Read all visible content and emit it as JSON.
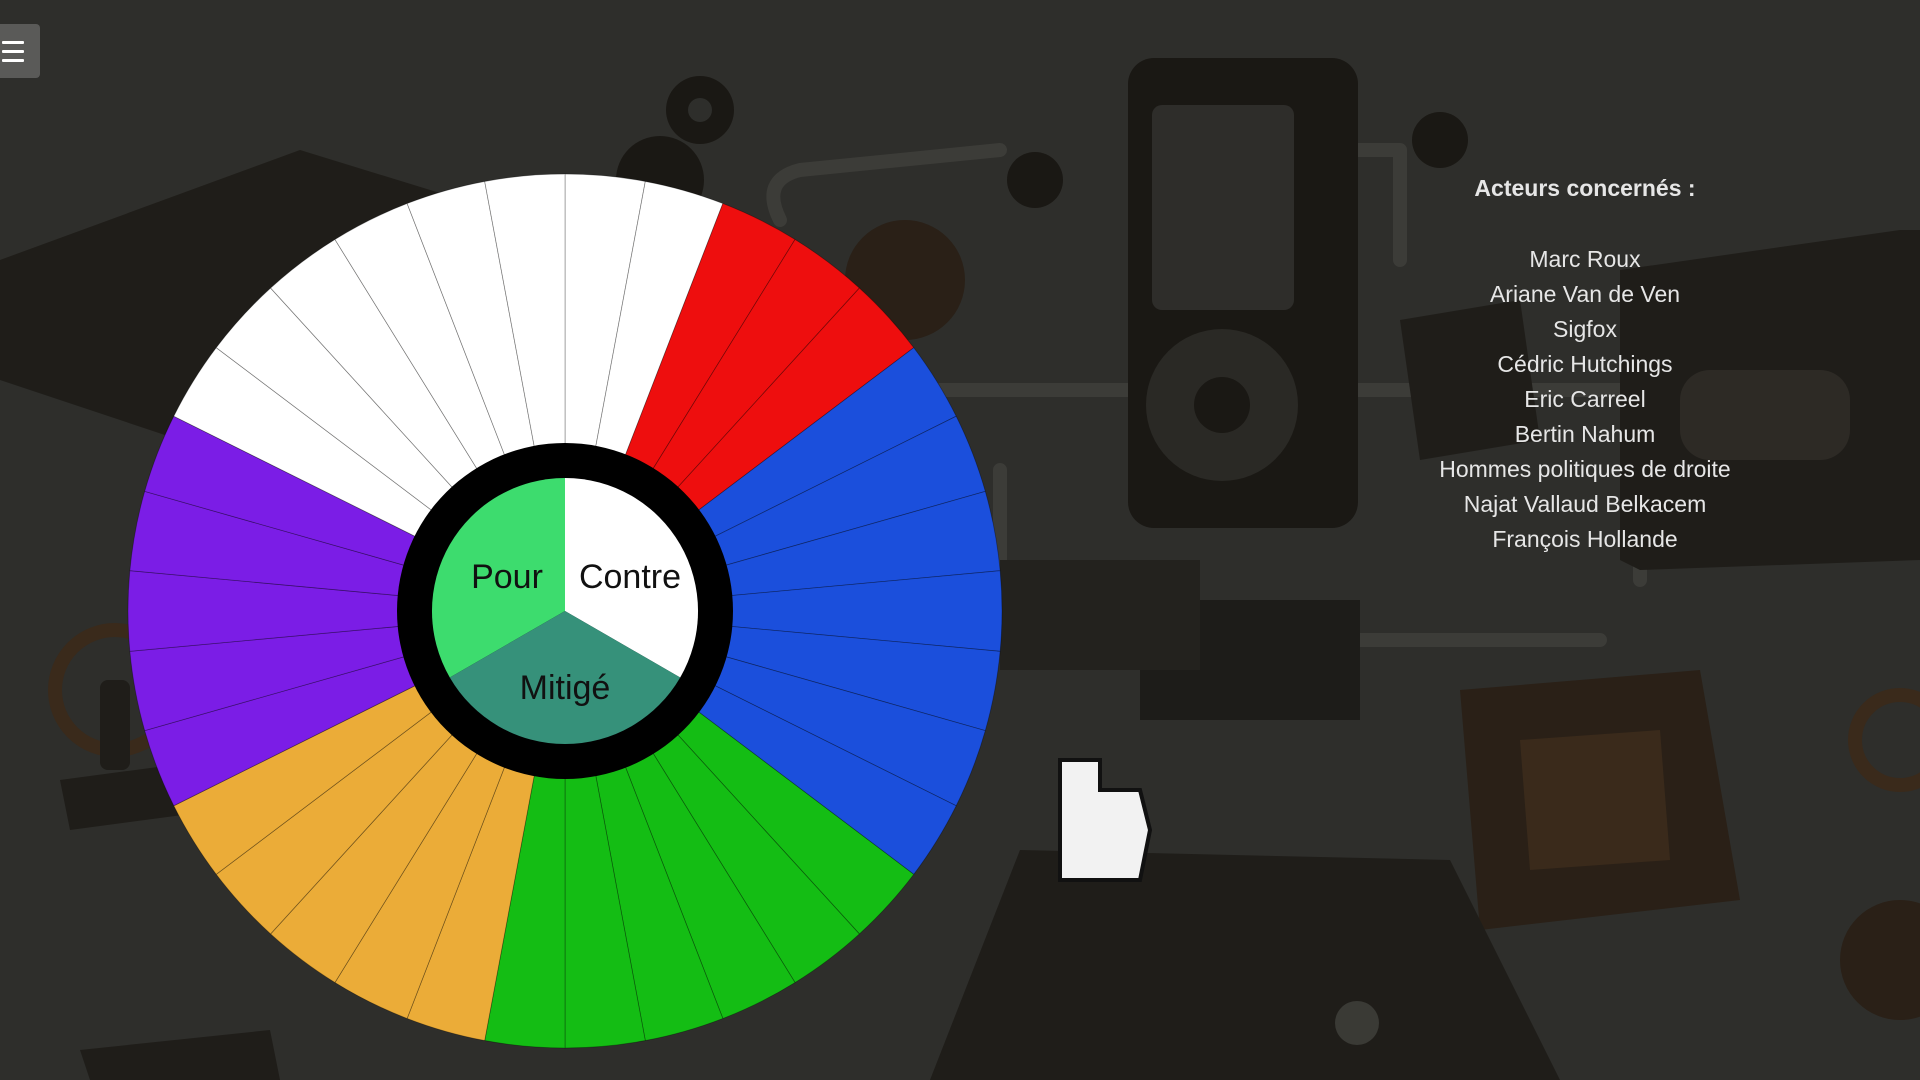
{
  "menu": {
    "icon": "hamburger-menu-icon"
  },
  "wheel": {
    "segment_colors": {
      "white": "#ffffff",
      "red": "#ee0e0e",
      "blue": "#1b4fdc",
      "green": "#14bd14",
      "orange": "#ebac38",
      "purple": "#7b1de6"
    },
    "segments": [
      "white",
      "white",
      "red",
      "red",
      "red",
      "blue",
      "blue",
      "blue",
      "blue",
      "blue",
      "blue",
      "blue",
      "green",
      "green",
      "green",
      "green",
      "green",
      "green",
      "orange",
      "orange",
      "orange",
      "orange",
      "orange",
      "purple",
      "purple",
      "purple",
      "purple",
      "purple",
      "white",
      "white",
      "white",
      "white",
      "white",
      "white"
    ],
    "ring_color": "#000000",
    "center": {
      "pour": {
        "label": "Pour",
        "color": "#3ddc6e"
      },
      "contre": {
        "label": "Contre",
        "color": "#ffffff"
      },
      "mitige": {
        "label": "Mitigé",
        "color": "#36917a"
      }
    }
  },
  "actors": {
    "title": "Acteurs concernés :",
    "items": [
      "Marc Roux",
      "Ariane Van de Ven",
      "Sigfox",
      "Cédric Hutchings",
      "Eric Carreel",
      "Bertin Nahum",
      "Hommes politiques de droite",
      "Najat Vallaud Belkacem",
      "François Hollande"
    ]
  }
}
